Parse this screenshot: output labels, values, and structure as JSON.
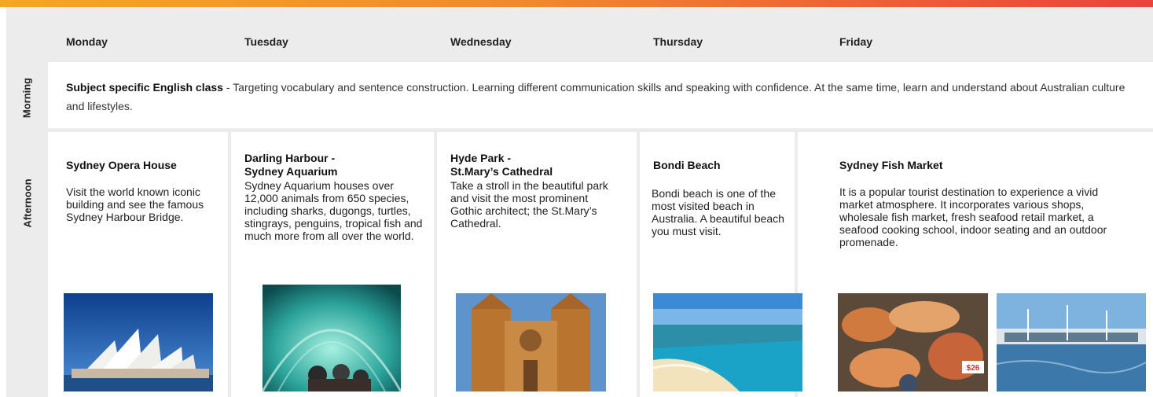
{
  "days": [
    "Monday",
    "Tuesday",
    "Wednesday",
    "Thursday",
    "Friday"
  ],
  "row_labels": {
    "morning": "Morning",
    "afternoon": "Afternoon"
  },
  "morning": {
    "title": "Subject specific English class",
    "text": " - Targeting vocabulary and sentence construction. Learning different communication skills and speaking with confidence. At the same time, learn and understand about Australian culture and lifestyles."
  },
  "afternoon": [
    {
      "title_1": "Sydney Opera House",
      "title_2": "",
      "desc": "Visit the world known iconic building and see the famous Sydney Harbour Bridge."
    },
    {
      "title_1": "Darling Harbour -",
      "title_2": "Sydney Aquarium",
      "desc": "Sydney Aquarium houses over 12,000 animals from 650 species, including sharks, dugongs, turtles, stingrays, penguins, tropical fish and much more from all over the world."
    },
    {
      "title_1": "Hyde Park -",
      "title_2": "St.Mary’s Cathedral",
      "desc": "Take a stroll in the beautiful park and visit the most prominent Gothic architect; the St.Mary’s Cathedral."
    },
    {
      "title_1": "Bondi Beach",
      "title_2": "",
      "desc": "Bondi beach is one of the most visited beach in Australia. A beautiful beach you must visit."
    },
    {
      "title_1": "Sydney Fish Market",
      "title_2": "",
      "desc": "It is a popular tourist destination to experience a vivid market atmosphere. It incorporates various shops, wholesale fish market, fresh seafood retail market, a seafood cooking school, indoor seating and an outdoor promenade."
    }
  ],
  "photo_labels": {
    "price_tag": "$26"
  },
  "colors": {
    "accent_start": "#f5a623",
    "accent_end": "#e8433c",
    "panel": "#ececec"
  }
}
